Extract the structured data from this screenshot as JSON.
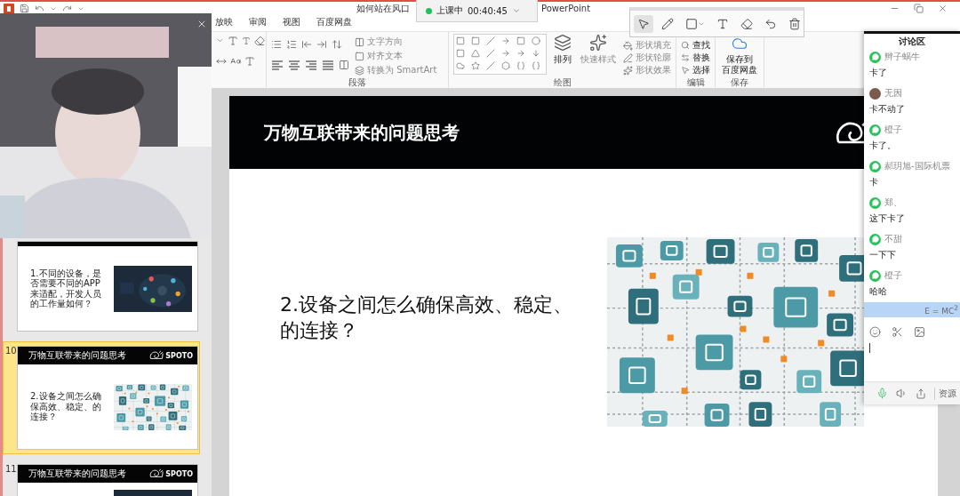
{
  "title_bar": {
    "title_start": "如何站在风口",
    "title_end": "PowerPoint"
  },
  "ribbon_tabs": [
    {
      "label": "放映",
      "selected": false
    },
    {
      "label": "审阅",
      "selected": false
    },
    {
      "label": "视图",
      "selected": false
    },
    {
      "label": "百度网盘",
      "selected": false
    }
  ],
  "ribbon": {
    "paragraph": {
      "label": "段落",
      "commands": [
        {
          "label": "文字方向",
          "disabled": true
        },
        {
          "label": "对齐文本",
          "disabled": true
        },
        {
          "label": "转换为 SmartArt",
          "disabled": true
        }
      ]
    },
    "drawing": {
      "label": "绘图",
      "arrange": {
        "label": "排列",
        "disabled": false
      },
      "quick_styles": {
        "label": "快速样式",
        "disabled": true
      },
      "commands": [
        {
          "label": "形状填充",
          "disabled": true
        },
        {
          "label": "形状轮廓",
          "disabled": true
        },
        {
          "label": "形状效果",
          "disabled": true
        }
      ]
    },
    "editing": {
      "label": "编辑",
      "commands": [
        {
          "label": "查找"
        },
        {
          "label": "替换"
        },
        {
          "label": "选择"
        }
      ]
    },
    "save": {
      "label": "保存",
      "button": [
        "保存到",
        "百度网盘"
      ]
    }
  },
  "thumbnails": [
    {
      "body": "1.不同的设备，是否需要不同的APP来适配，开发人员的工作量如何？",
      "selected": false
    },
    {
      "number": "10",
      "header": "万物互联带来的问题思考",
      "logo": "SPOTO",
      "body": "2.设备之间怎么确保高效、稳定、的连接？",
      "image": {
        "kind": "network"
      },
      "selected": true
    },
    {
      "number": "11",
      "header": "万物互联带来的问题思考",
      "logo": "SPOTO",
      "selected": false
    }
  ],
  "slide": {
    "title": "万物互联带来的问题思考",
    "body": "2.设备之间怎么确保高效、稳定、的连接？",
    "image": {
      "kind": "network"
    }
  },
  "class_timer": {
    "live": true,
    "status": "上课中",
    "time": "00:40:45"
  },
  "draw_tools": [
    {
      "kind": "pointer",
      "selected": true
    },
    {
      "kind": "pen",
      "selected": false
    },
    {
      "kind": "shape",
      "selected": false
    },
    {
      "kind": "text",
      "selected": false
    },
    {
      "kind": "eraser",
      "selected": false
    },
    {
      "kind": "undo",
      "selected": false
    },
    {
      "kind": "delete",
      "selected": false
    }
  ],
  "chat": {
    "title": "讨论区",
    "messages": [
      {
        "name": "辫子蜗牛",
        "kind": "wechat",
        "text": "卡了"
      },
      {
        "name": "无因",
        "text": "卡不动了"
      },
      {
        "name": "橙子",
        "kind": "wechat",
        "text": "卡了。"
      },
      {
        "name": "郝玥旭-国际机票",
        "kind": "wechat",
        "text": "卡"
      },
      {
        "name": "郑、",
        "kind": "wechat",
        "text": "这下卡了"
      },
      {
        "name": "不甜",
        "kind": "wechat",
        "text": "一下下"
      },
      {
        "name": "橙子",
        "kind": "wechat",
        "text": "哈哈"
      }
    ],
    "banner": "E = MC$^{2}$",
    "mic_on": true,
    "resources_tab": "资源"
  }
}
